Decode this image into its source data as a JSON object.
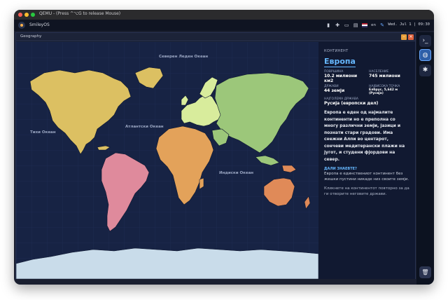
{
  "host_window": {
    "title": "QEMU - (Press ^⌥G to release Mouse)"
  },
  "os_bar": {
    "name": "SmileyOS",
    "language": "en",
    "clock": "Wed. Jul 1 | 09:30"
  },
  "app": {
    "title": "Geography",
    "minimize_label": "–",
    "close_label": "×"
  },
  "map": {
    "ocean_labels": {
      "arctic": "Северен Леден Океан",
      "pacific": "Тихи Океан",
      "atlantic": "Атлантски Океан",
      "indian": "Индиски Океан"
    },
    "continent_colors": {
      "north_america": "#dcc062",
      "south_america": "#df8a9c",
      "europe": "#d8ec9c",
      "africa": "#e3a25a",
      "asia": "#9cc77a",
      "oceania": "#e08a58",
      "antarctica": "#c9dcea"
    }
  },
  "panel": {
    "kicker": "КОНТИНЕНТ",
    "title": "Европа",
    "stats": {
      "area_label": "ПОВРШИНА",
      "area_value": "10.2 милиони км2",
      "population_label": "НАСЕЛЕНИЕ",
      "population_value": "745 милиони",
      "countries_label": "ДРЖАВИ",
      "countries_value": "44 земји",
      "highest_label": "НАЈВИСОКА ТОЧКА",
      "highest_value": "Елбрус, 5,642 м (Русија)",
      "largest_label": "НАЈГОЛЕМА ДРЖАВА",
      "largest_value": "Русија (европски дел)"
    },
    "description": "Европа е еден од најмалите континенти но е преполна со многу различни земји, јазици и познати стари градови. Има снежни Алпи во центарот, сончеви медитерански плажи на југот, и студени фјордови на север.",
    "fact_heading": "ДАЛИ ЗНАЕВТЕ?",
    "fact_body": "Европа е единствениот континент без жешки пустини никаде низ своите земји.",
    "hint": "Кликнете на континентот повторно за да ги отворите неговите држави."
  },
  "dock": {
    "terminal_icon": "›_",
    "globe_icon": "◍",
    "settings_icon": "✱",
    "trash_icon": "🗑"
  }
}
